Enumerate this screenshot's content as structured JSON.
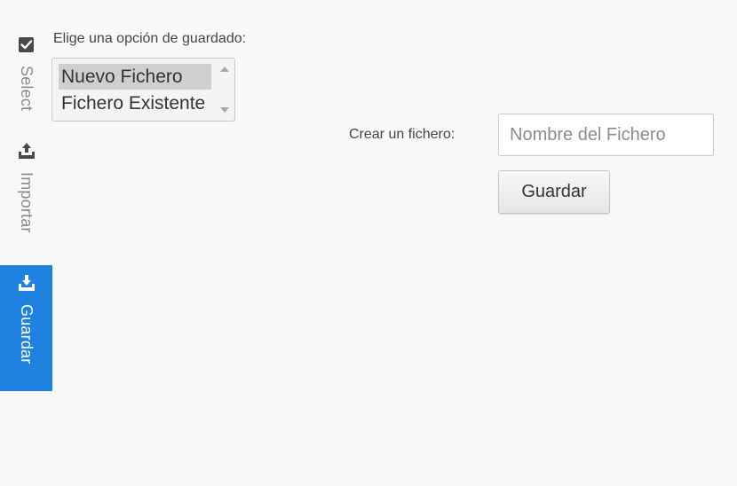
{
  "sidebar": {
    "tabs": [
      {
        "label": "Select",
        "icon": "checkbox-icon",
        "active": false
      },
      {
        "label": "Importar",
        "icon": "upload-icon",
        "active": false
      },
      {
        "label": "Guardar",
        "icon": "download-icon",
        "active": true
      }
    ],
    "active_color": "#1f82e0"
  },
  "save_options": {
    "label": "Elige una opción de guardado:",
    "options": [
      "Nuevo Fichero",
      "Fichero Existente"
    ],
    "selected": "Nuevo Fichero"
  },
  "create_file": {
    "label": "Crear un fichero:",
    "placeholder": "Nombre del Fichero",
    "value": "",
    "button_label": "Guardar"
  }
}
